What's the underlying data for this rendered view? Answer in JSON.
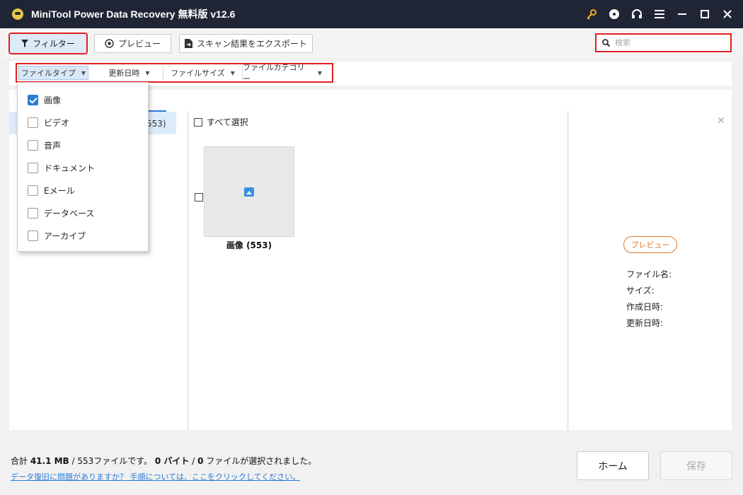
{
  "window": {
    "title": "MiniTool Power Data Recovery 無料版 v12.6",
    "icons": [
      "key-icon",
      "disc-icon",
      "headset-icon",
      "menu-icon",
      "minimize-icon",
      "maximize-icon",
      "close-icon"
    ],
    "accent_color": "#1f2535"
  },
  "toolbar": {
    "filter_label": "フィルター",
    "preview_label": "プレビュー",
    "export_label": "スキャン結果をエクスポート",
    "search_placeholder": "検索"
  },
  "filters": {
    "file_type": "ファイルタイプ",
    "modified_date": "更新日時",
    "file_size": "ファイルサイズ",
    "file_category": "ファイルカテゴリー"
  },
  "file_type_dropdown": {
    "items": [
      {
        "label": "画像",
        "checked": true
      },
      {
        "label": "ビデオ",
        "checked": false
      },
      {
        "label": "音声",
        "checked": false
      },
      {
        "label": "ドキュメント",
        "checked": false
      },
      {
        "label": "Eメール",
        "checked": false
      },
      {
        "label": "データベース",
        "checked": false
      },
      {
        "label": "アーカイブ",
        "checked": false
      }
    ]
  },
  "left_panel": {
    "selected_count": "553)"
  },
  "content": {
    "select_all": "すべて選択",
    "thumbnail_label": "画像 (553)"
  },
  "preview_panel": {
    "preview_button": "プレビュー",
    "file_name_label": "ファイル名:",
    "size_label": "サイズ:",
    "created_label": "作成日時:",
    "modified_label": "更新日時:"
  },
  "footer": {
    "total_prefix": "合計 ",
    "total_size": "41.1 MB",
    "total_sep": " / 553ファイルです。 ",
    "selected_bytes": "0 バイト",
    "selected_sep": " / ",
    "selected_files": "0",
    "selected_suffix": " ファイルが選択されました。",
    "help_link": "データ復旧に問題がありますか？ 手順については、ここをクリックしてください。",
    "home_button": "ホーム",
    "save_button": "保存"
  }
}
